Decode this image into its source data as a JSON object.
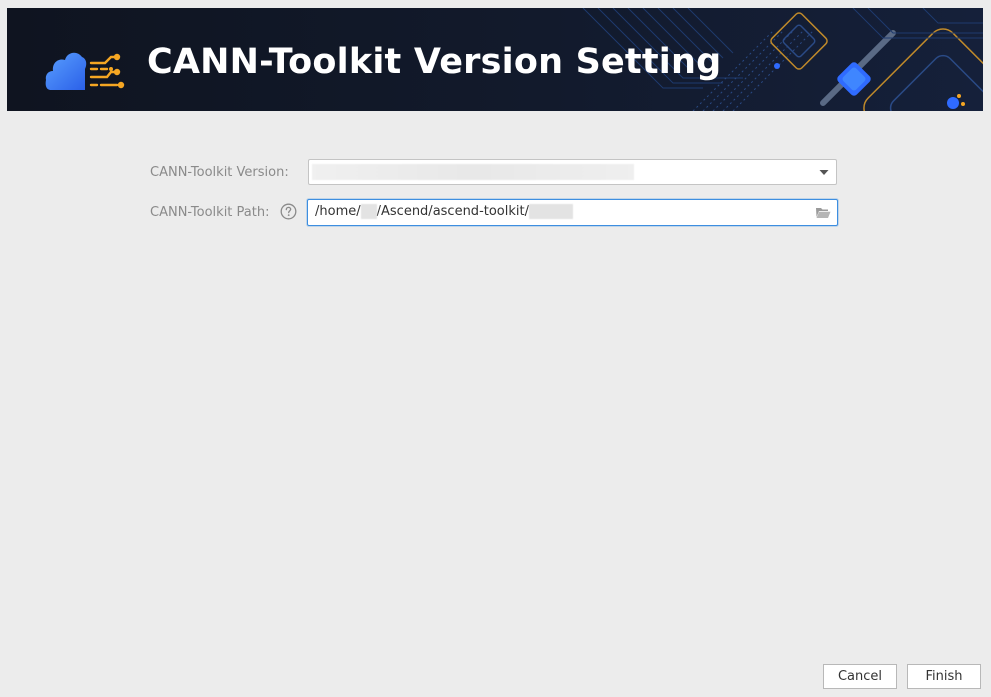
{
  "banner": {
    "title": "CANN-Toolkit Version Setting",
    "logo_icon": "cloud-circuit-logo-icon"
  },
  "form": {
    "version": {
      "label": "CANN-Toolkit Version:",
      "value": "",
      "dropdown_icon": "chevron-down-icon"
    },
    "path": {
      "label": "CANN-Toolkit Path:",
      "help_icon": "question-circle-icon",
      "prefix": "/home/",
      "middle": "/Ascend/ascend-toolkit/",
      "browse_icon": "folder-open-icon"
    }
  },
  "buttons": {
    "cancel": "Cancel",
    "finish": "Finish"
  },
  "colors": {
    "banner_bg": "#0f1420",
    "logo_blue": "#3a7bff",
    "logo_orange": "#f5a623",
    "focus_border": "#3d8ee0",
    "window_bg": "#ececec"
  }
}
